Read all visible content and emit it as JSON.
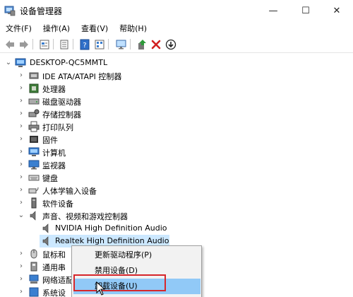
{
  "window": {
    "title": "设备管理器",
    "min_glyph": "—",
    "max_glyph": "☐",
    "close_glyph": "✕"
  },
  "menu": {
    "items": [
      "文件(F)",
      "操作(A)",
      "查看(V)",
      "帮助(H)"
    ]
  },
  "toolbar": {
    "buttons": [
      "back-arrow",
      "forward-arrow",
      "properties",
      "show-hidden",
      "help",
      "device-view",
      "scan-monitor",
      "update-driver",
      "uninstall-x",
      "disable-down"
    ]
  },
  "tree": {
    "root": "DESKTOP-QC5MMTL",
    "categories": [
      "IDE ATA/ATAPI 控制器",
      "处理器",
      "磁盘驱动器",
      "存储控制器",
      "打印队列",
      "固件",
      "计算机",
      "监视器",
      "键盘",
      "人体学输入设备",
      "软件设备",
      "声音、视频和游戏控制器"
    ],
    "audio_children": [
      "NVIDIA High Definition Audio",
      "Realtek High Definition Audio"
    ],
    "after": [
      "鼠标和",
      "通用串",
      "网络适配",
      "系统设"
    ]
  },
  "context_menu": {
    "items": [
      "更新驱动程序(P)",
      "禁用设备(D)",
      "卸载设备(U)"
    ]
  },
  "colors": {
    "selection": "#cce8ff",
    "menu_highlight": "#91c9f7",
    "annotation_red": "#d6262b"
  }
}
